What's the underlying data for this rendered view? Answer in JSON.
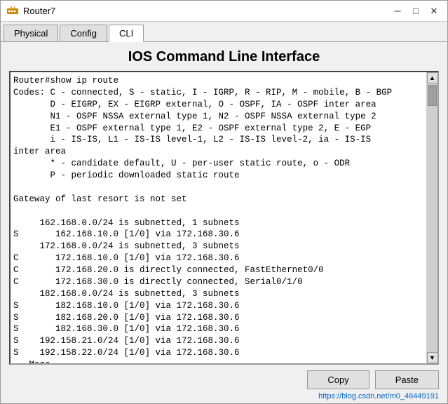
{
  "window": {
    "title": "Router7",
    "icon": "router-icon"
  },
  "title_controls": {
    "minimize": "─",
    "maximize": "□",
    "close": "✕"
  },
  "tabs": [
    {
      "label": "Physical",
      "active": false
    },
    {
      "label": "Config",
      "active": false
    },
    {
      "label": "CLI",
      "active": true
    }
  ],
  "page_title": "IOS Command Line Interface",
  "cli_output": "Router#show ip route\nCodes: C - connected, S - static, I - IGRP, R - RIP, M - mobile, B - BGP\n       D - EIGRP, EX - EIGRP external, O - OSPF, IA - OSPF inter area\n       N1 - OSPF NSSA external type 1, N2 - OSPF NSSA external type 2\n       E1 - OSPF external type 1, E2 - OSPF external type 2, E - EGP\n       i - IS-IS, L1 - IS-IS level-1, L2 - IS-IS level-2, ia - IS-IS\ninter area\n       * - candidate default, U - per-user static route, o - ODR\n       P - periodic downloaded static route\n\nGateway of last resort is not set\n\n     162.168.0.0/24 is subnetted, 1 subnets\nS       162.168.10.0 [1/0] via 172.168.30.6\n     172.168.0.0/24 is subnetted, 3 subnets\nC       172.168.10.0 [1/0] via 172.168.30.6\nC       172.168.20.0 is directly connected, FastEthernet0/0\nC       172.168.30.0 is directly connected, Serial0/1/0\n     182.168.0.0/24 is subnetted, 3 subnets\nS       182.168.10.0 [1/0] via 172.168.30.6\nS       182.168.20.0 [1/0] via 172.168.30.6\nS       182.168.30.0 [1/0] via 172.168.30.6\nS    192.158.21.0/24 [1/0] via 172.168.30.6\nS    192.158.22.0/24 [1/0] via 172.168.30.6\n --More--",
  "buttons": {
    "copy": "Copy",
    "paste": "Paste"
  },
  "status_url": "https://blog.csdn.net/m0_48449191"
}
